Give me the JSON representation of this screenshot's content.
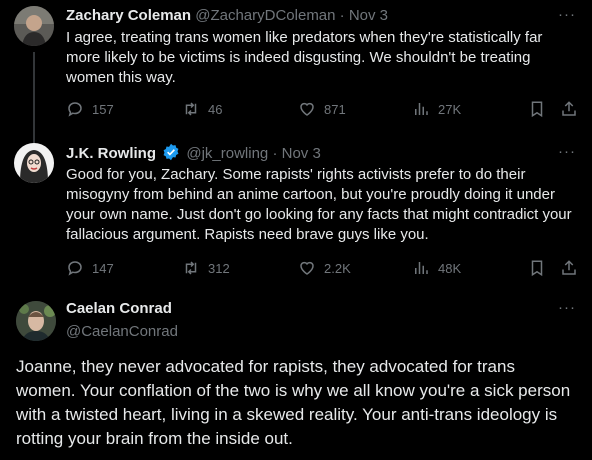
{
  "tweets": [
    {
      "name": "Zachary Coleman",
      "handle": "@ZacharyDColeman",
      "separator": "·",
      "date": "Nov 3",
      "text": "I agree, treating trans women like predators when they're statistically far more likely to be victims is indeed disgusting. We shouldn't be treating women this way.",
      "replies": "157",
      "reposts": "46",
      "likes": "871",
      "views": "27K"
    },
    {
      "name": "J.K. Rowling",
      "handle": "@jk_rowling",
      "separator": "·",
      "date": "Nov 3",
      "verified": true,
      "text": "Good for you, Zachary. Some rapists' rights activists prefer to do their misogyny from behind an anime cartoon, but you're proudly doing it under your own name. Just don't go looking for any facts that might contradict your fallacious argument. Rapists need brave guys like you.",
      "replies": "147",
      "reposts": "312",
      "likes": "2.2K",
      "views": "48K"
    },
    {
      "name": "Caelan Conrad",
      "handle": "@CaelanConrad",
      "text": "Joanne, they never advocated for rapists, they advocated for trans women. Your conflation of the two is why we all know you're a sick person with a twisted heart, living in a skewed reality. Your anti-trans ideology is rotting your brain from the inside out."
    }
  ],
  "more_label": "···",
  "icons": {
    "reply": "reply-icon",
    "repost": "repost-icon",
    "like": "like-icon",
    "views": "views-icon",
    "bookmark": "bookmark-icon",
    "share": "share-icon",
    "verified": "verified-badge-icon"
  },
  "colors": {
    "background": "#000000",
    "text": "#e7e9ea",
    "muted": "#71767b",
    "verified": "#1d9bf0"
  }
}
